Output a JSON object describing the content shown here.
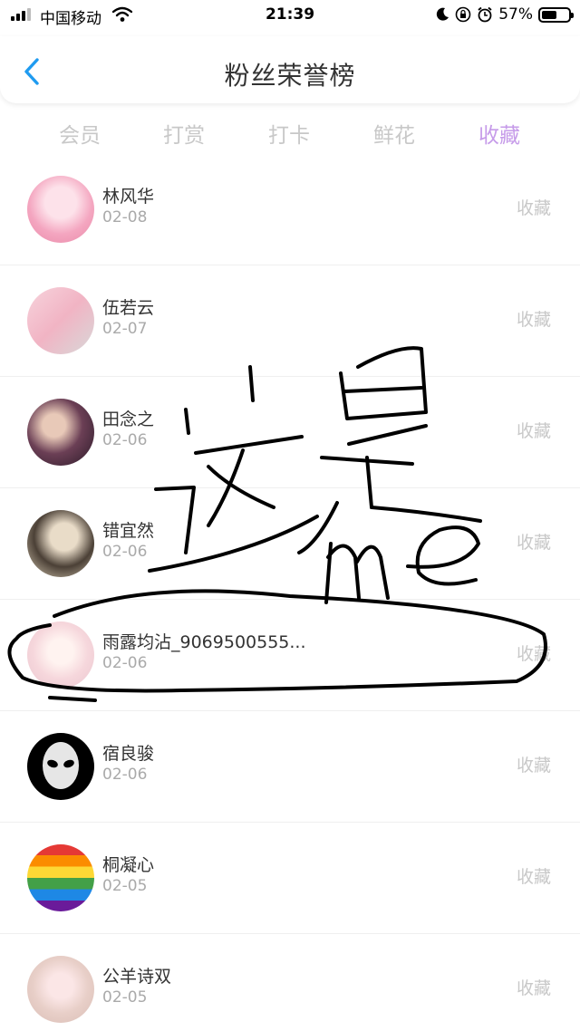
{
  "status_bar": {
    "carrier": "中国移动",
    "time": "21:39",
    "battery": "57%",
    "battery_level": 0.57
  },
  "header": {
    "title": "粉丝荣誉榜",
    "back_icon": "chevron-left-icon",
    "accent": "#1f9bf0"
  },
  "tabs": [
    {
      "label": "会员",
      "active": false
    },
    {
      "label": "打赏",
      "active": false
    },
    {
      "label": "打卡",
      "active": false
    },
    {
      "label": "鲜花",
      "active": false
    },
    {
      "label": "收藏",
      "active": true
    }
  ],
  "tab_active_color": "#c69be9",
  "fans": [
    {
      "name": "林风华",
      "date": "02-08",
      "action": "收藏"
    },
    {
      "name": "伍若云",
      "date": "02-07",
      "action": "收藏"
    },
    {
      "name": "田念之",
      "date": "02-06",
      "action": "收藏"
    },
    {
      "name": "错宜然",
      "date": "02-06",
      "action": "收藏"
    },
    {
      "name": "雨露均沾_9069500555...",
      "date": "02-06",
      "action": "收藏"
    },
    {
      "name": "宿良骏",
      "date": "02-06",
      "action": "收藏"
    },
    {
      "name": "桐凝心",
      "date": "02-05",
      "action": "收藏"
    },
    {
      "name": "公羊诗双",
      "date": "02-05",
      "action": "收藏"
    }
  ],
  "annotation": {
    "handwritten_text": "这是 me",
    "ink_color": "#000000"
  }
}
